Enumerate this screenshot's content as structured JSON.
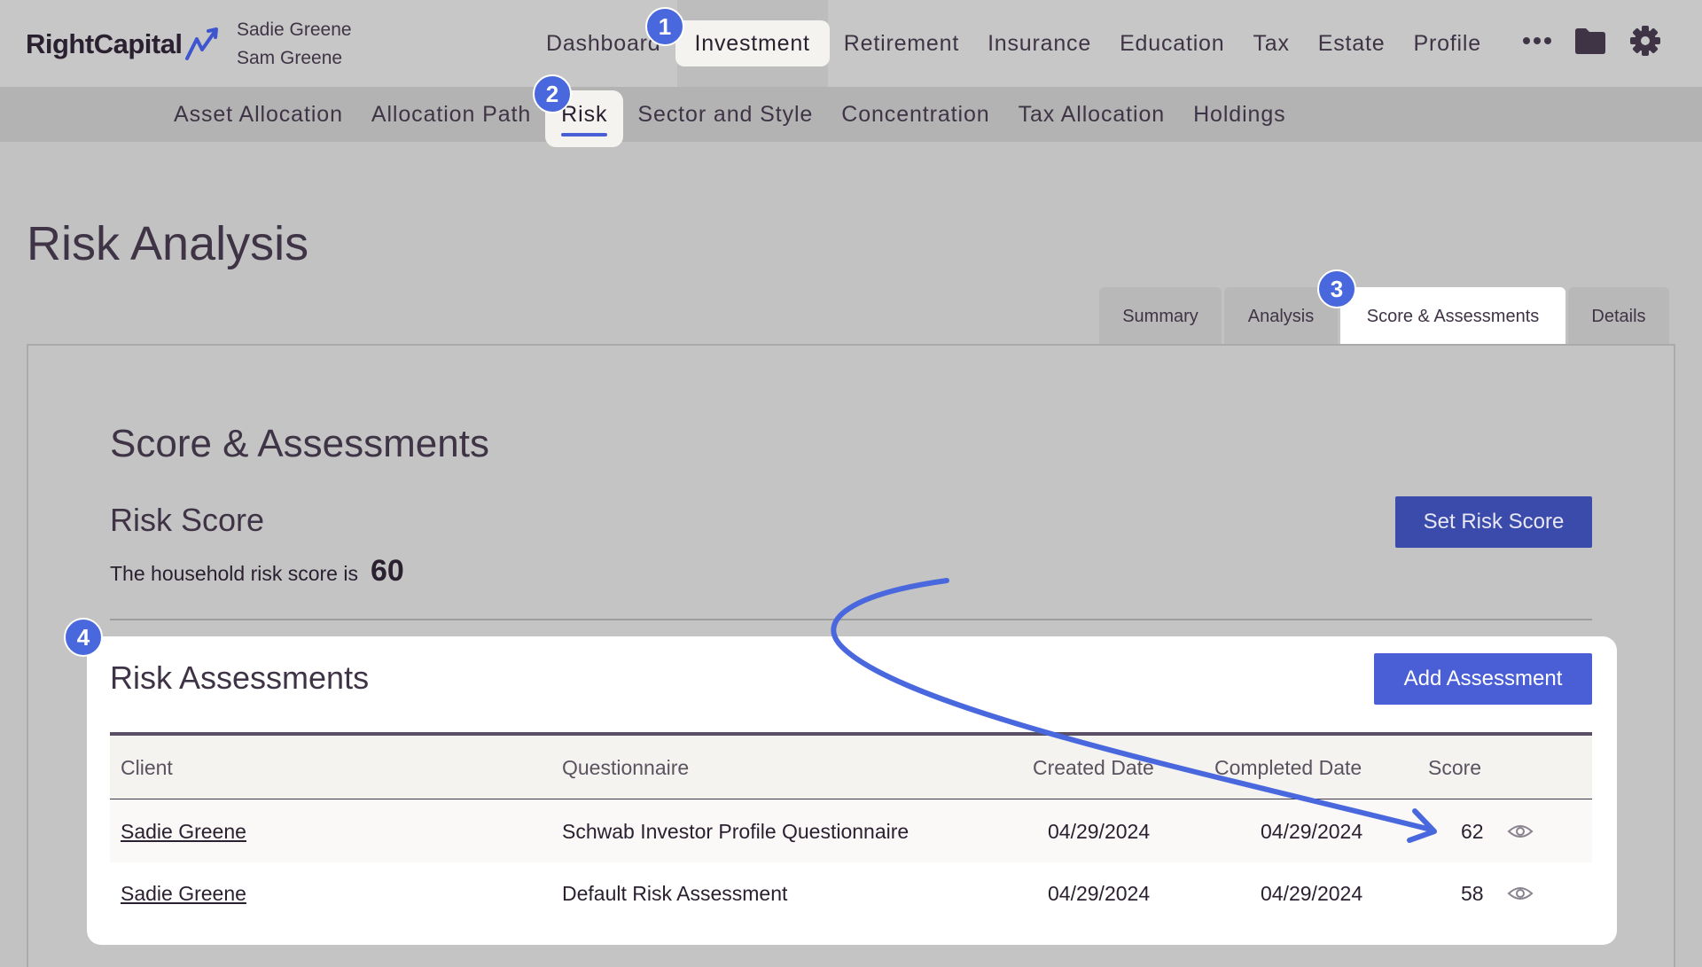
{
  "brand": {
    "name": "RightCapital"
  },
  "household": {
    "primary": "Sadie Greene",
    "secondary": "Sam Greene"
  },
  "main_nav": {
    "items": [
      "Dashboard",
      "Investment",
      "Retirement",
      "Insurance",
      "Education",
      "Tax",
      "Estate",
      "Profile"
    ],
    "active": "Investment"
  },
  "top_icons": [
    "more-icon",
    "folder-icon",
    "gear-icon"
  ],
  "sub_nav": {
    "items": [
      "Asset Allocation",
      "Allocation Path",
      "Risk",
      "Sector and Style",
      "Concentration",
      "Tax Allocation",
      "Holdings"
    ],
    "active": "Risk"
  },
  "page": {
    "title": "Risk Analysis"
  },
  "tabs": {
    "items": [
      "Summary",
      "Analysis",
      "Score & Assessments",
      "Details"
    ],
    "active": "Score & Assessments"
  },
  "section": {
    "title": "Score & Assessments",
    "risk_score": {
      "title": "Risk Score",
      "text": "The household risk score is",
      "value": "60",
      "button": "Set Risk Score"
    },
    "risk_assessments": {
      "title": "Risk Assessments",
      "button": "Add Assessment",
      "columns": [
        "Client",
        "Questionnaire",
        "Created Date",
        "Completed Date",
        "Score"
      ],
      "rows": [
        {
          "client": "Sadie Greene",
          "questionnaire": "Schwab Investor Profile Questionnaire",
          "created": "04/29/2024",
          "completed": "04/29/2024",
          "score": "62"
        },
        {
          "client": "Sadie Greene",
          "questionnaire": "Default Risk Assessment",
          "created": "04/29/2024",
          "completed": "04/29/2024",
          "score": "58"
        }
      ]
    }
  },
  "callouts": [
    "1",
    "2",
    "3",
    "4"
  ],
  "colors": {
    "accent": "#4a5fd6",
    "badge": "#4a68dd",
    "set_button": "#3b4bab",
    "text": "#3f3446"
  }
}
